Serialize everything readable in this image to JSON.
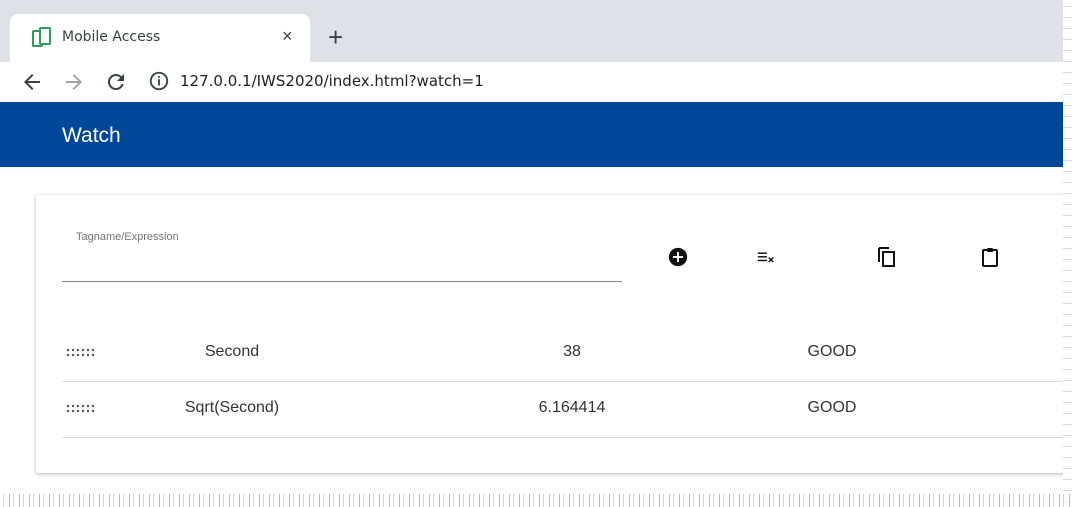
{
  "browser": {
    "tab_title": "Mobile Access",
    "close_glyph": "×",
    "new_tab_glyph": "+",
    "url": "127.0.0.1/IWS2020/index.html?watch=1",
    "icons": [
      "back-icon",
      "forward-icon",
      "reload-icon",
      "info-icon"
    ]
  },
  "app": {
    "title": "Watch",
    "accent_color": "#004699"
  },
  "watch": {
    "field_label": "Tagname/Expression",
    "field_value": "",
    "actions": [
      "add-icon",
      "clear-all-icon",
      "copy-icon",
      "paste-icon"
    ],
    "rows": [
      {
        "name": "Second",
        "value": "38",
        "quality": "GOOD"
      },
      {
        "name": "Sqrt(Second)",
        "value": "6.164414",
        "quality": "GOOD"
      }
    ]
  }
}
